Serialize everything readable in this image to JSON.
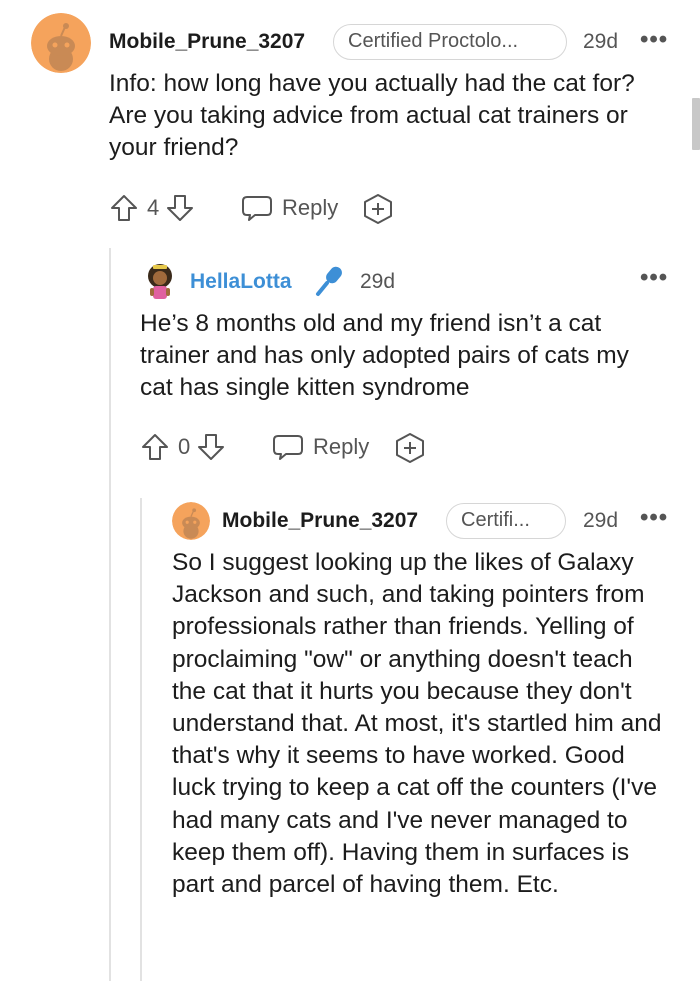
{
  "comments": [
    {
      "username": "Mobile_Prune_3207",
      "flair": "Certified Proctolo...",
      "time": "29d",
      "more": "•••",
      "body": "Info: how long have you actually had the cat for? Are you taking advice from actual cat trainers or your friend?",
      "votes": "4",
      "reply_label": "Reply",
      "avatar_icon": "snoo-avatar-icon"
    },
    {
      "username": "HellaLotta",
      "user_icon": "microphone-icon",
      "time": "29d",
      "more": "•••",
      "body": "He’s 8 months old and my friend isn’t a cat trainer and has only adopted pairs of cats my cat has single kitten syndrome",
      "votes": "0",
      "reply_label": "Reply",
      "avatar_icon": "custom-avatar-icon"
    },
    {
      "username": "Mobile_Prune_3207",
      "flair": "Certifi...",
      "time": "29d",
      "more": "•••",
      "body": "So I suggest looking up the likes of Galaxy Jackson and such, and taking pointers from professionals rather than friends. Yelling of proclaiming \"ow\" or anything doesn't teach the cat that it hurts you because they don't understand that. At most, it's startled him and that's why it seems to have worked. Good luck trying to keep a cat off the counters (I've had many cats and I've never managed to keep them off). Having them in surfaces is part and parcel of having them. Etc.",
      "avatar_icon": "snoo-avatar-icon"
    }
  ],
  "colors": {
    "username_blue": "#3d8fd6",
    "avatar_orange": "#f5a35c",
    "thread_line": "#e2e2e2"
  }
}
